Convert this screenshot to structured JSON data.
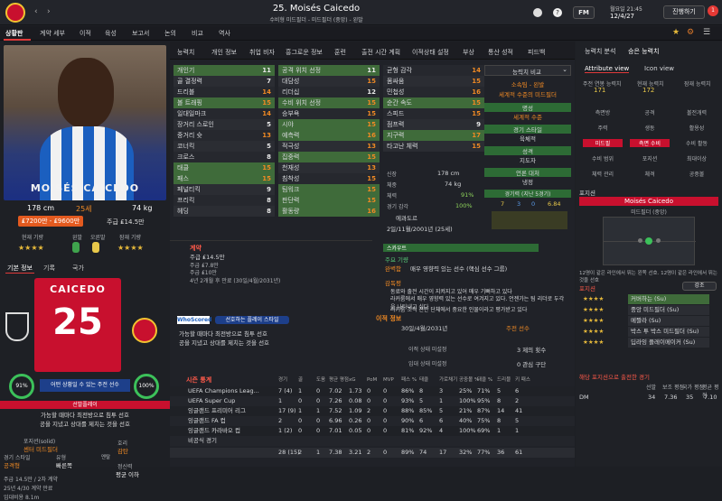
{
  "header": {
    "title": "25. Moisés Caicedo",
    "subtitle": "수비형 미드필더 - 미드필더 (중앙) - 왼발",
    "date_line1": "월요일 21:45",
    "date_line2": "12/4/27",
    "fm_label": "FM",
    "continue_label": "진행하기",
    "badge_count": "1"
  },
  "nav": {
    "items": [
      "상황판",
      "계약 세부",
      "이적",
      "육성",
      "보고서",
      "논의",
      "비교",
      "역사"
    ],
    "active": 0
  },
  "player": {
    "name_overlay": "MOISÉS CAICEDO",
    "height": "178 cm",
    "age": "25세",
    "weight": "74 kg",
    "value": "₤7200만 - ₤9600만",
    "wage": "주급 ₤14.5만",
    "current_ability_label": "현재 기량",
    "potential_label": "잠재 기량",
    "morale_label": "컨디",
    "form_label": "오른발",
    "left_label": "왼발",
    "cur_stars": "★★★★",
    "pot_stars": "★★★★",
    "tabs": [
      "기본 정보",
      "기록",
      "국가"
    ],
    "shirt_name": "CAICEDO",
    "shirt_number": "25",
    "ring1": "91%",
    "ring2": "100%",
    "role_text": "어떤 상황일 수 있는 주전 선수",
    "status_red": "선발플레이",
    "pref_line1": "가능할 때마다 최전방으로 침투 선호",
    "pref_line2": "공을 지녔고 상대를 제치는 것을 선호",
    "bottom": [
      {
        "k": "포지션(solid)",
        "v": "센터 미드필더"
      },
      {
        "k": "경기 스타일",
        "v": "공격형"
      },
      {
        "k": "유형",
        "v": "빠른쪽"
      },
      {
        "k": "호리",
        "v": "감탄"
      },
      {
        "k": "멘탈",
        "v": "부상당하면 쉽게 안 좋은 정도"
      },
      {
        "k": "정신력",
        "v": "평균 이하"
      }
    ],
    "bottom_small": [
      "주급 14.5만 / 2차 계약",
      "25년 4/30 계약 만료",
      "임대비용 8.1m"
    ]
  },
  "mid": {
    "tabs": [
      "능력치",
      "개인 정보",
      "취업 비자",
      "흥그로운 정보",
      "훈련",
      "출전 시간 계획",
      "이적상태 설정",
      "부상",
      "통산 성적",
      "피드백"
    ],
    "col1": [
      {
        "n": "개인기",
        "v": "11",
        "c": "w",
        "hl": true
      },
      {
        "n": "골 결정력",
        "v": "7",
        "c": "w"
      },
      {
        "n": "드리블",
        "v": "14",
        "c": "o"
      },
      {
        "n": "볼 트래핑",
        "v": "15",
        "c": "o",
        "hl": true
      },
      {
        "n": "일대일마크",
        "v": "14",
        "c": "o"
      },
      {
        "n": "장거리 스로인",
        "v": "5",
        "c": "w"
      },
      {
        "n": "중거리 슛",
        "v": "13",
        "c": "o"
      },
      {
        "n": "코너킥",
        "v": "5",
        "c": "w"
      },
      {
        "n": "크로스",
        "v": "8",
        "c": "w"
      },
      {
        "n": "태클",
        "v": "15",
        "c": "o",
        "hl": true
      },
      {
        "n": "패스",
        "v": "15",
        "c": "o",
        "hl": true
      },
      {
        "n": "페널티킥",
        "v": "9",
        "c": "w"
      },
      {
        "n": "프리킥",
        "v": "8",
        "c": "w"
      },
      {
        "n": "헤딩",
        "v": "8",
        "c": "w"
      }
    ],
    "col2": [
      {
        "n": "공격 위치 선정",
        "v": "11",
        "c": "w",
        "hl": true
      },
      {
        "n": "대담성",
        "v": "15",
        "c": "o"
      },
      {
        "n": "리더십",
        "v": "12",
        "c": "w"
      },
      {
        "n": "수비 위치 선정",
        "v": "15",
        "c": "o",
        "hl": true
      },
      {
        "n": "승부욕",
        "v": "15",
        "c": "o"
      },
      {
        "n": "시야",
        "v": "15",
        "c": "o",
        "hl": true
      },
      {
        "n": "예측력",
        "v": "16",
        "c": "o",
        "hl": true
      },
      {
        "n": "적극성",
        "v": "13",
        "c": "o"
      },
      {
        "n": "집중력",
        "v": "15",
        "c": "o",
        "hl": true
      },
      {
        "n": "천재성",
        "v": "13",
        "c": "o"
      },
      {
        "n": "침착성",
        "v": "15",
        "c": "o"
      },
      {
        "n": "팀워크",
        "v": "15",
        "c": "o",
        "hl": true
      },
      {
        "n": "판단력",
        "v": "15",
        "c": "o",
        "hl": true
      },
      {
        "n": "활동량",
        "v": "16",
        "c": "o",
        "hl": true
      }
    ],
    "col3": [
      {
        "n": "균형 감각",
        "v": "14",
        "c": "o"
      },
      {
        "n": "몸싸움",
        "v": "15",
        "c": "o"
      },
      {
        "n": "민첩성",
        "v": "16",
        "c": "o"
      },
      {
        "n": "순간 속도",
        "v": "15",
        "c": "o",
        "hl": true
      },
      {
        "n": "스피드",
        "v": "15",
        "c": "o"
      },
      {
        "n": "점프력",
        "v": "9",
        "c": "w"
      },
      {
        "n": "지구력",
        "v": "17",
        "c": "o",
        "hl": true
      },
      {
        "n": "타고난 체력",
        "v": "15",
        "c": "o"
      }
    ],
    "compare_label": "능력치 비교",
    "foot": "소속팀 - 왼발",
    "foot_sub": "세계적 수준의 미드필더",
    "s1": "명성",
    "s1v": "세계적 수준",
    "s2": "경기 스타일",
    "s2v": "육체적",
    "s3": "성격",
    "s3v": "지도자",
    "s4": "언론 대처",
    "s4v": "냉정",
    "perf_label": "경기력 (지난 5경기)",
    "perf_vals": [
      "7",
      "3",
      "0",
      "6.84"
    ],
    "phys": [
      {
        "k": "신장",
        "v": "178 cm"
      },
      {
        "k": "체중",
        "v": "74 kg"
      },
      {
        "k": "체력",
        "v": "91%"
      },
      {
        "k": "경기 감각",
        "v": "100%"
      }
    ],
    "nation": "에콰도르",
    "dob": "2일/11월/2001년 (25세)",
    "contract_title": "계약",
    "contract_wage": "주급 ₤14.5만",
    "contract_a": "주급 ₤7.8만",
    "contract_b": "주급 ₤10만",
    "contract_exp": "4년 2개월 후 만료 (30일/4월/2031년)",
    "scout_tab": "스카우트",
    "key_title": "주요 기량",
    "k1": "완벽함",
    "k1d": "매우 영향력 있는 선수 (핵심 선수 그룹)",
    "note_title": "감독평",
    "notes": [
      "동료와 출전 시간이 지켜지고 있어 매우 기뻐하고 있다",
      "라커룸에서 매우 영향력 있는 선수로 여겨지고 있다. 언젠가는 팀 리더로 두각을 나타내고 싶다",
      "라커룸 조직 전반 단체에서 중요한 인물이라고 평가받고 있다"
    ],
    "whoscored": "선호하는 플레이 스타일",
    "ws1": "가능할 때마다 최전방으로 침투 선호",
    "ws2": "공을 지녔고 상대를 제치는 것을 선호",
    "transfer_title": "이적 정보",
    "tr_date": "30일/4월/2031년",
    "tr_status": "주전 선수",
    "tr_a": "이적 상태 미설정",
    "tr_b": "임대 상태 미설정",
    "tr_c": "3 제의 횟수",
    "tr_d": "0 관심 구단",
    "stats_title": "시즌 통계",
    "stats_cols": [
      "경기",
      "골",
      "도움",
      "평균 평점",
      "xG",
      "PoM",
      "MVP",
      "패스 %",
      "태클",
      "가로채기",
      "공중볼 %",
      "태클 %",
      "드리블",
      "키 패스"
    ],
    "stats": [
      {
        "comp": "UEFA Champions Leag...",
        "v": [
          "7 (4)",
          "1",
          "0",
          "7.02",
          "1.73",
          "0",
          "0",
          "86%",
          "8",
          "3",
          "25%",
          "71%",
          "5",
          "6"
        ]
      },
      {
        "comp": "UEFA Super Cup",
        "v": [
          "1",
          "0",
          "0",
          "7.26",
          "0.08",
          "0",
          "0",
          "93%",
          "5",
          "1",
          "100%",
          "95%",
          "8",
          "2"
        ]
      },
      {
        "comp": "잉글랜드 프리미어 리그",
        "v": [
          "17 (9)",
          "1",
          "1",
          "7.52",
          "1.09",
          "2",
          "0",
          "88%",
          "85%",
          "5",
          "21%",
          "87%",
          "14",
          "41"
        ]
      },
      {
        "comp": "잉글랜드 FA 컵",
        "v": [
          "2",
          "0",
          "0",
          "6.96",
          "0.26",
          "0",
          "0",
          "90%",
          "6",
          "6",
          "40%",
          "75%",
          "8",
          "5"
        ]
      },
      {
        "comp": "잉글랜드 카라바오 컵",
        "v": [
          "1 (2)",
          "0",
          "0",
          "7.01",
          "0.05",
          "0",
          "0",
          "81%",
          "92%",
          "4",
          "100%",
          "69%",
          "1",
          "1"
        ]
      },
      {
        "comp": "비공식 경기",
        "v": [
          "",
          "",
          "",
          "",
          "",
          "",
          "",
          "",
          "",
          "",
          "",
          "",
          "",
          ""
        ]
      }
    ],
    "total": [
      "28 (15)",
      "2",
      "1",
      "7.38",
      "3.21",
      "2",
      "0",
      "89%",
      "74",
      "17",
      "32%",
      "77%",
      "36",
      "61"
    ]
  },
  "right": {
    "tabs": [
      "능력치 분석",
      "승은 능력치"
    ],
    "subtabs": [
      "Attribute view",
      "Icon view"
    ],
    "r1": [
      {
        "k": "주전 연봉 능력치",
        "v": "171"
      },
      {
        "k": "현재 능력치",
        "v": "172"
      },
      {
        "k": "잠재 능력치",
        "v": ""
      }
    ],
    "grid": [
      [
        "측면방",
        "공격",
        "볼전개력"
      ],
      [
        "주력",
        "생동",
        "활용성"
      ],
      [
        "미드필",
        "측면 수비",
        "수비 활동"
      ],
      [
        "수비 범위",
        "포지션",
        "최대이상"
      ],
      [
        "체력 관리",
        "체격",
        "공중볼"
      ]
    ],
    "pos_title": "포지션",
    "pos_name": "Moisés Caicedo",
    "pos_sub": "미드필더 (중앙)",
    "pos_note": "12명이 같은 라인에서 뛰는 왼쪽 선호. 12명이 같은 라인에서 뛰는 것을 선호",
    "role_title": "포지션",
    "role_btn": "강조",
    "roles": [
      {
        "s": "★★★★",
        "n": "커버하는 (Su)"
      },
      {
        "s": "★★★★",
        "n": "중앙 미드필더 (Su)"
      },
      {
        "s": "★★★★",
        "n": "메짤라 (Su)"
      },
      {
        "s": "★★★★",
        "n": "박스 투 박스 미드필더 (Su)"
      },
      {
        "s": "★★★★",
        "n": "딥라잉 플레이메이커 (Su)"
      }
    ],
    "bottom_title": "해당 포지션으로 출전한 경기",
    "bottom_cols": [
      "선발",
      "보조 평점",
      "국가 평점",
      "평균 평점"
    ],
    "bottom_row": {
      "pos": "DM",
      "v": [
        "34",
        "7.36",
        "35",
        "7.10"
      ]
    }
  }
}
